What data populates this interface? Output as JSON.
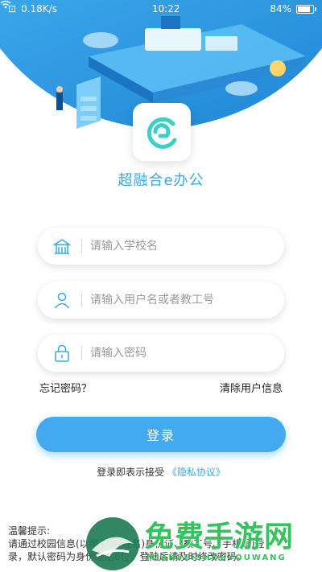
{
  "status_bar": {
    "network_speed": "0.18K/s",
    "time": "10:22",
    "battery": "84%",
    "battery_level": 0.84
  },
  "app": {
    "name": "超融合e办公"
  },
  "form": {
    "school_placeholder": "请输入学校名",
    "username_placeholder": "请输入用户名或者教工号",
    "password_placeholder": "请输入密码"
  },
  "links": {
    "forgot_password": "忘记密码？",
    "clear_user_info": "清除用户信息"
  },
  "login_button": "登录",
  "agreement": {
    "prefix": "登录即表示接受",
    "link": "《隐私协议》"
  },
  "tips": {
    "title": "温馨提示:",
    "line1": "请通过校园信息(以用户名(姓名)身份证、教工号、手机号)登",
    "line2": "录，默认密码为身份证后6位，登陆后请及时修改密码。"
  },
  "watermark": {
    "text": "免费手游网",
    "sub": "MIANFEISHOUYOUWANG"
  },
  "colors": {
    "primary": "#44aaf0",
    "header": "#2e9be4",
    "watermark": "#35c25f"
  }
}
